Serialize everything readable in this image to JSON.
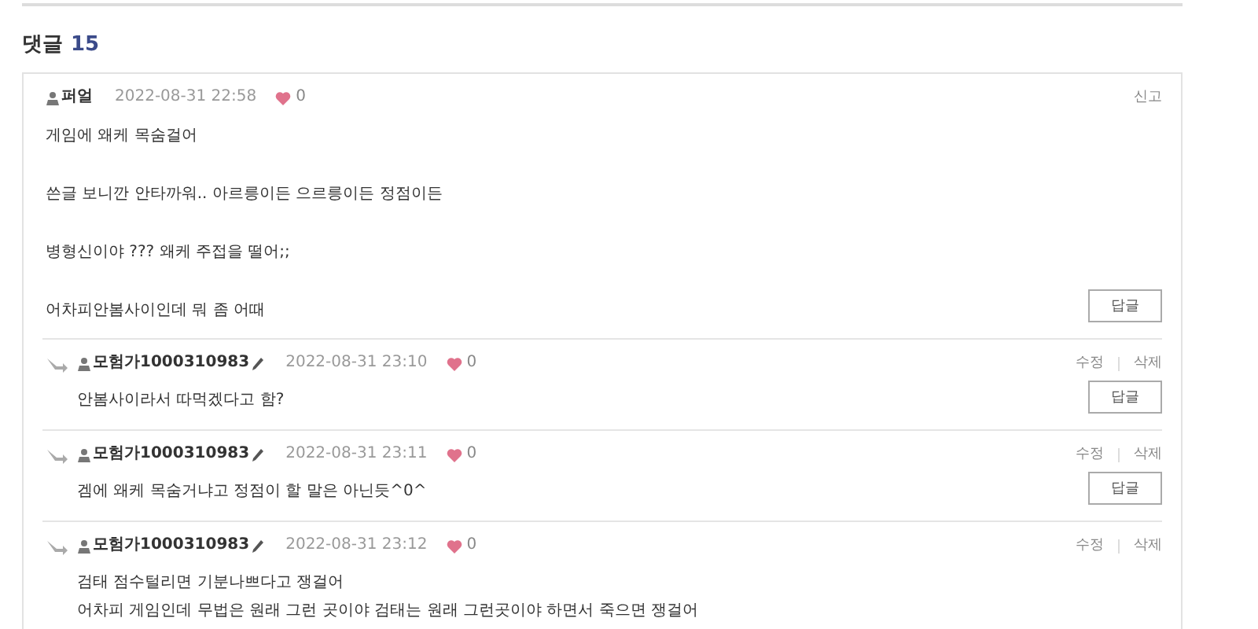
{
  "section": {
    "title": "댓글",
    "count": "15"
  },
  "comments": [
    {
      "kind": "comment",
      "author": "퍼얼",
      "edited": false,
      "date": "2022-08-31 22:58",
      "likes": "0",
      "actions": [
        "신고"
      ],
      "paragraphs": [
        [
          "게임에 왜케 목숨걸어"
        ],
        [
          "쓴글 보니깐 안타까워.. 아르릉이든 으르릉이든 정점이든"
        ],
        [
          "병형신이야 ??? 왜케 주접을 떨어;;"
        ],
        [
          "어차피안봄사이인데 뭐 좀 어때"
        ]
      ],
      "reply_button": "답글"
    },
    {
      "kind": "reply",
      "author": "모험가1000310983",
      "edited": true,
      "date": "2022-08-31 23:10",
      "likes": "0",
      "actions": [
        "수정",
        "삭제"
      ],
      "paragraphs": [
        [
          "안봄사이라서 따먹겠다고 함?"
        ]
      ],
      "reply_button": "답글"
    },
    {
      "kind": "reply",
      "author": "모험가1000310983",
      "edited": true,
      "date": "2022-08-31 23:11",
      "likes": "0",
      "actions": [
        "수정",
        "삭제"
      ],
      "paragraphs": [
        [
          "겜에 왜케 목숨거냐고 정점이 할 말은 아닌듯^0^"
        ]
      ],
      "reply_button": "답글"
    },
    {
      "kind": "reply",
      "author": "모험가1000310983",
      "edited": true,
      "date": "2022-08-31 23:12",
      "likes": "0",
      "actions": [
        "수정",
        "삭제"
      ],
      "paragraphs": [
        [
          "검태 점수털리면 기분나쁘다고 쟁걸어",
          "어차피 게임인데 무법은 원래 그런 곳이야 검태는 원래 그런곳이야 하면서 죽으면 쟁걸어"
        ]
      ]
    }
  ]
}
